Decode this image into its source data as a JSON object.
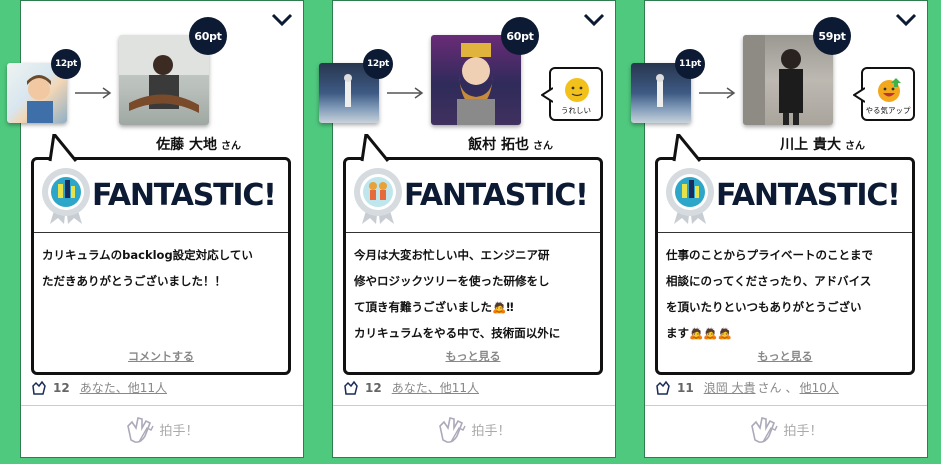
{
  "colors": {
    "background": "#4fc97e",
    "navy": "#0c1a33",
    "muted": "#888888"
  },
  "cards": [
    {
      "sender_points": "12pt",
      "receiver_points": "60pt",
      "receiver_name": "佐藤 大地",
      "honorific": "さん",
      "reaction": null,
      "badge_title": "FANTASTIC!",
      "message_lines": [
        "カリキュラムのbacklog設定対応してい",
        "ただきありがとうございました！！"
      ],
      "footer_link": "コメントする",
      "like_count": "12",
      "likers": "あなた、他11人",
      "applause_label": "拍手！"
    },
    {
      "sender_points": "12pt",
      "receiver_points": "60pt",
      "receiver_name": "飯村 拓也",
      "honorific": "さん",
      "reaction": {
        "label": "うれしい",
        "icon": "smile-face-icon"
      },
      "badge_title": "FANTASTIC!",
      "message_lines": [
        "今月は大変お忙しい中、エンジニア研",
        "修やロジックツリーを使った研修をし",
        "て頂き有難うございました🙇‼",
        "カリキュラムをやる中で、技術面以外に"
      ],
      "footer_link": "もっと見る",
      "like_count": "12",
      "likers": "あなた、他11人",
      "applause_label": "拍手！"
    },
    {
      "sender_points": "11pt",
      "receiver_points": "59pt",
      "receiver_name": "川上 貴大",
      "honorific": "さん",
      "reaction": {
        "label": "やる気アップ",
        "icon": "motivated-face-icon"
      },
      "badge_title": "FANTASTIC!",
      "message_lines": [
        "仕事のことからプライベートのことまで",
        "相談にのってくださったり、アドバイス",
        "を頂いたりといつもありがとうござい",
        "ます🙇🙇🙇"
      ],
      "footer_link": "もっと見る",
      "like_count": "11",
      "likers_name": "浪岡 大貴",
      "likers_honorific": "さん",
      "likers_sep": "、",
      "likers": "他10人",
      "applause_label": "拍手！"
    }
  ]
}
